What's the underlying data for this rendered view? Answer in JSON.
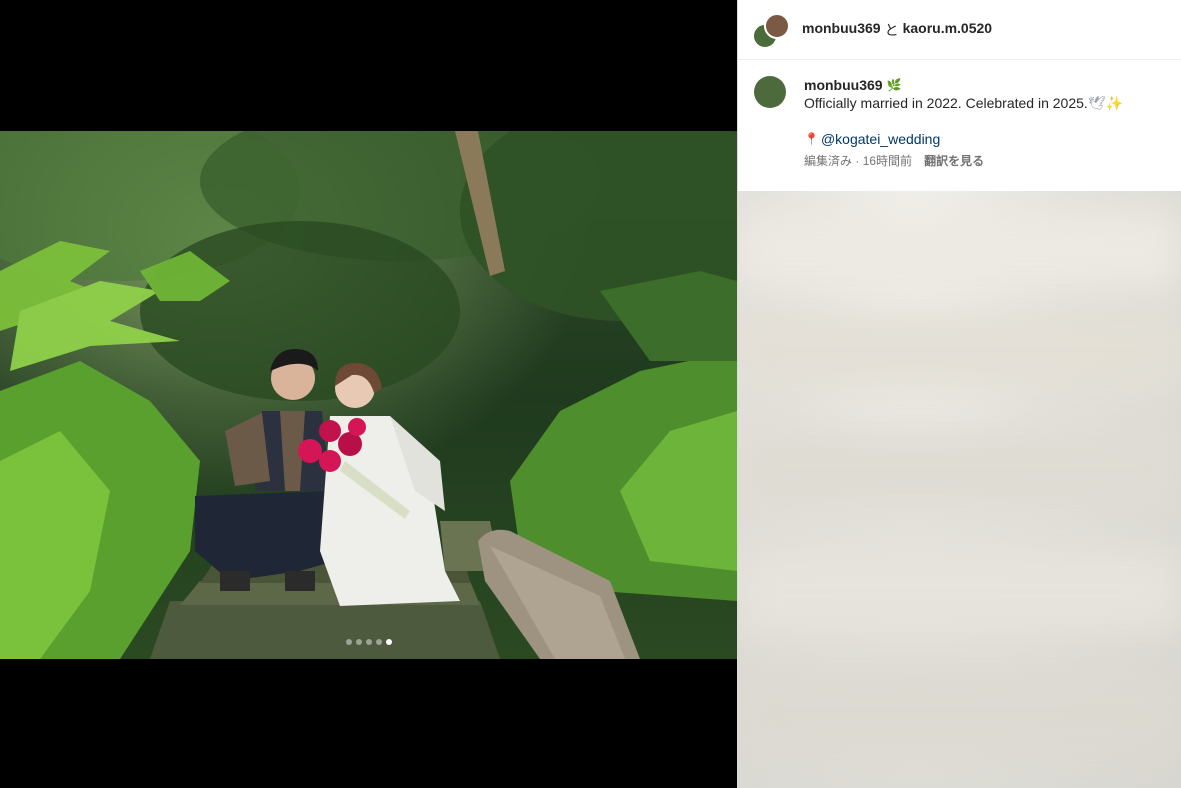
{
  "header": {
    "user1": "monbuu369",
    "separator": "と",
    "user2": "kaoru.m.0520"
  },
  "caption": {
    "username": "monbuu369",
    "username_badge_icon": "leaf-icon",
    "text": "Officially married in 2022. Celebrated in 2025.",
    "trailing_icons": [
      "dove-icon",
      "sparkle-icon"
    ],
    "location_icon": "pin-icon",
    "location_link": "@kogatei_wedding",
    "edited": "編集済み",
    "time": "16時間前",
    "time_separator": "·",
    "translate_label": "翻訳を見る"
  },
  "carousel": {
    "total": 5,
    "active_index": 4
  },
  "colors": {
    "link": "#00376b",
    "meta": "#737373",
    "bouquet": "#d41657"
  }
}
